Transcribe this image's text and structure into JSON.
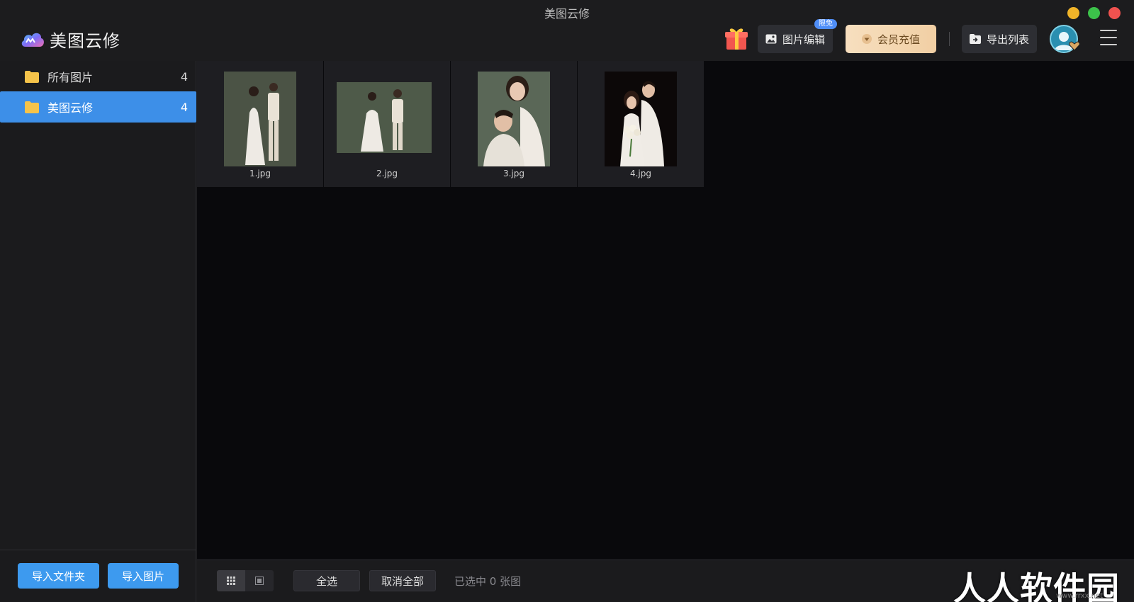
{
  "window": {
    "title": "美图云修"
  },
  "header": {
    "app_name": "美图云修",
    "edit_label": "图片编辑",
    "edit_badge": "限免",
    "vip_label": "会员充值",
    "export_label": "导出列表"
  },
  "sidebar": {
    "items": [
      {
        "label": "所有图片",
        "count": "4"
      },
      {
        "label": "美图云修",
        "count": "4"
      }
    ],
    "import_folder_label": "导入文件夹",
    "import_image_label": "导入图片"
  },
  "gallery": {
    "images": [
      {
        "name": "1.jpg"
      },
      {
        "name": "2.jpg"
      },
      {
        "name": "3.jpg"
      },
      {
        "name": "4.jpg"
      }
    ]
  },
  "footer": {
    "select_all_label": "全选",
    "deselect_all_label": "取消全部",
    "selection_status": "已选中 0 张图"
  },
  "watermark": {
    "text": "人人软件园",
    "url": "www.rrxx.net"
  },
  "colors": {
    "accent": "#3d8fe8",
    "vip_gold": "#f1cfa4",
    "badge_blue": "#4f8ef7",
    "win_min": "#f0b429",
    "win_max": "#3cc24a",
    "win_close": "#f0524f"
  }
}
